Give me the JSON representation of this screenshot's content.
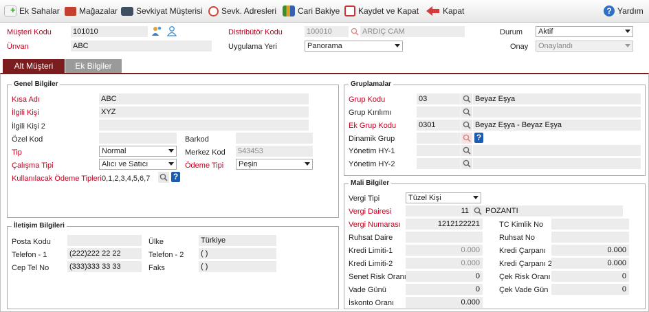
{
  "toolbar": {
    "ek_sahalar": "Ek Sahalar",
    "magazalar": "Mağazalar",
    "sevkiyat_musterisi": "Sevkiyat Müşterisi",
    "sevk_adresleri": "Sevk. Adresleri",
    "cari_bakiye": "Cari Bakiye",
    "kaydet_kapat": "Kaydet ve Kapat",
    "kapat": "Kapat",
    "yardim": "Yardım"
  },
  "header": {
    "musteri_kodu_label": "Müşteri Kodu",
    "musteri_kodu": "101010",
    "unvan_label": "Ünvan",
    "unvan": "ABC",
    "distributor_kodu_label": "Distribütör Kodu",
    "distributor_kodu": "100010",
    "distributor_adi": "ARDIÇ CAM",
    "uygulama_yeri_label": "Uygulama Yeri",
    "uygulama_yeri": "Panorama",
    "durum_label": "Durum",
    "durum": "Aktif",
    "onay_label": "Onay",
    "onay": "Onaylandı"
  },
  "tabs": [
    {
      "label": "Alt Müşteri",
      "active": true
    },
    {
      "label": "Ek Bilgiler",
      "active": false
    }
  ],
  "genel": {
    "title": "Genel Bilgiler",
    "kisa_adi_label": "Kısa Adı",
    "kisa_adi": "ABC",
    "ilgili_kisi_label": "İlgili Kişi",
    "ilgili_kisi": "XYZ",
    "ilgili_kisi2_label": "İlgili Kişi 2",
    "ilgili_kisi2": "",
    "ozel_kod_label": "Özel Kod",
    "ozel_kod": "",
    "barkod_label": "Barkod",
    "barkod": "",
    "tip_label": "Tip",
    "tip": "Normal",
    "merkez_kod_label": "Merkez Kod",
    "merkez_kod": "543453",
    "calisma_tipi_label": "Çalışma Tipi",
    "calisma_tipi": "Alıcı ve Satıcı",
    "odeme_tipi_label": "Ödeme Tipi",
    "odeme_tipi": "Peşin",
    "kullanilacak_odeme_label": "Kullanılacak Ödeme Tipleri",
    "kullanilacak_odeme": "0,1,2,3,4,5,6,7"
  },
  "iletisim": {
    "title": "İletişim Bilgileri",
    "posta_kodu_label": "Posta Kodu",
    "posta_kodu": "",
    "telefon1_label": "Telefon - 1",
    "telefon1": "(222)222 22 22",
    "cep_tel_label": "Cep Tel No",
    "cep_tel": "(333)333 33 33",
    "ulke_label": "Ülke",
    "ulke": "Türkiye",
    "telefon2_label": "Telefon - 2",
    "telefon2": "(   )",
    "faks_label": "Faks",
    "faks": "(   )"
  },
  "gruplamalar": {
    "title": "Gruplamalar",
    "grup_kodu_label": "Grup Kodu",
    "grup_kodu": "03",
    "grup_kodu_adi": "Beyaz Eşya",
    "grup_kirilimi_label": "Grup Kırılımı",
    "ek_grup_kodu_label": "Ek Grup Kodu",
    "ek_grup_kodu": "0301",
    "ek_grup_kodu_adi": "Beyaz Eşya - Beyaz Eşya",
    "dinamik_grup_label": "Dinamik Grup",
    "yonetim_hy1_label": "Yönetim HY-1",
    "yonetim_hy2_label": "Yönetim HY-2"
  },
  "mali": {
    "title": "Mali Bilgiler",
    "vergi_tipi_label": "Vergi Tipi",
    "vergi_tipi": "Tüzel Kişi",
    "vergi_dairesi_label": "Vergi Dairesi",
    "vergi_dairesi_kod": "11",
    "vergi_dairesi_adi": "POZANTI",
    "vergi_numarasi_label": "Vergi Numarası",
    "vergi_numarasi": "1212122221",
    "tc_kimlik_label": "TC Kimlik No",
    "ruhsat_daire_label": "Ruhsat Daire",
    "ruhsat_no_label": "Ruhsat No",
    "kredi_limiti1_label": "Kredi Limiti-1",
    "kredi_limiti1": "0.000",
    "kredi_carpani_label": "Kredi Çarpanı",
    "kredi_carpani": "0.000",
    "kredi_limiti2_label": "Kredi Limiti-2",
    "kredi_limiti2": "0.000",
    "kredi_carpani2_label": "Kredi Çarpanı 2",
    "kredi_carpani2": "0.000",
    "senet_risk_label": "Senet Risk Oranı",
    "senet_risk": "0",
    "cek_risk_label": "Çek Risk Oranı",
    "cek_risk": "0",
    "vade_gunu_label": "Vade Günü",
    "vade_gunu": "0",
    "cek_vade_label": "Çek Vade Gün",
    "cek_vade": "0",
    "iskonto_label": "İskonto Oranı",
    "iskonto": "0.000"
  },
  "colors": {
    "accent": "#7b1d1f",
    "required": "#c0001e",
    "help": "#1b5cb0"
  }
}
